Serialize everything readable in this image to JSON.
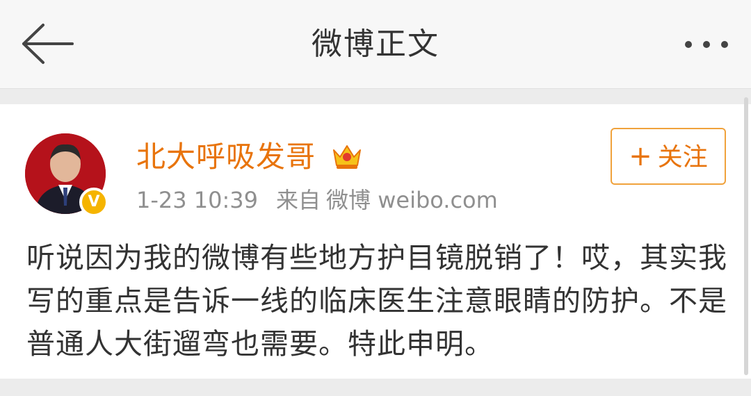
{
  "header": {
    "title": "微博正文",
    "back_icon": "arrow-left-icon",
    "more_icon": "more-dots-icon"
  },
  "post": {
    "author": {
      "name": "北大呼吸发哥",
      "verified_badge": "V",
      "avatar": "avatar-photo",
      "vip_icon": "crown-icon"
    },
    "timestamp": "1-23 10:39",
    "source_label": "来自",
    "source": "微博 weibo.com",
    "follow_label": "关注",
    "follow_icon": "+",
    "content": "听说因为我的微博有些地方护目镜脱销了！哎，其实我写的重点是告诉一线的临床医生注意眼睛的防护。不是普通人大街遛弯也需要。特此申明。"
  },
  "colors": {
    "accent": "#e8740c",
    "follow_border": "#f0a23c",
    "meta_text": "#8f8f8f",
    "body_text": "#333333",
    "badge": "#f5b400",
    "avatar_bg": "#c3131a"
  }
}
